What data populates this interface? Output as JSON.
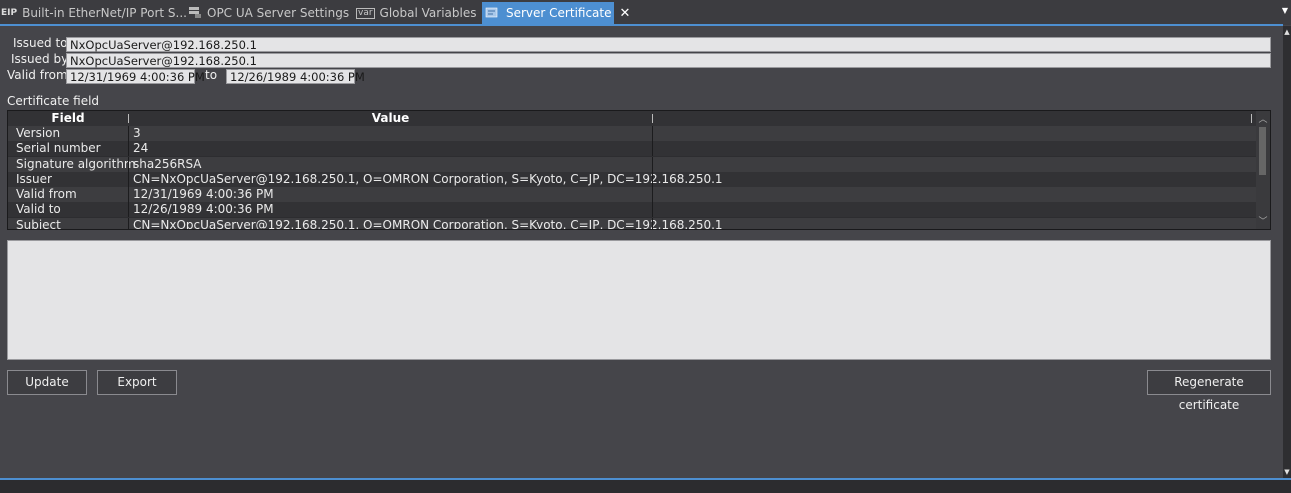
{
  "tabs": [
    {
      "icon": "EIP",
      "label": "Built-in EtherNet/IP Port S..."
    },
    {
      "icon": "opc",
      "label": "OPC UA Server Settings"
    },
    {
      "icon": "var",
      "label": "Global Variables"
    },
    {
      "icon": "cert",
      "label": "Server Certificate"
    }
  ],
  "active_tab": 3,
  "form": {
    "issued_to_label": "Issued to",
    "issued_to_value": "NxOpcUaServer@192.168.250.1",
    "issued_by_label": "Issued by",
    "issued_by_value": "NxOpcUaServer@192.168.250.1",
    "valid_from_label": "Valid from",
    "valid_from_value": "12/31/1969 4:00:36 PM",
    "to_label": "to",
    "valid_to_value": "12/26/1989 4:00:36 PM"
  },
  "certificate_field_label": "Certificate field",
  "grid": {
    "headers": [
      "Field",
      "Value"
    ],
    "rows": [
      [
        "Version",
        "3"
      ],
      [
        "Serial number",
        "24"
      ],
      [
        "Signature algorithm",
        "sha256RSA"
      ],
      [
        "Issuer",
        "CN=NxOpcUaServer@192.168.250.1, O=OMRON Corporation, S=Kyoto, C=JP, DC=192.168.250.1"
      ],
      [
        "Valid from",
        "12/31/1969 4:00:36 PM"
      ],
      [
        "Valid to",
        "12/26/1989 4:00:36 PM"
      ],
      [
        "Subject",
        "CN=NxOpcUaServer@192.168.250.1, O=OMRON Corporation, S=Kyoto, C=JP, DC=192.168.250.1"
      ]
    ]
  },
  "buttons": {
    "update": "Update",
    "export": "Export",
    "regenerate": "Regenerate certificate"
  },
  "colors": {
    "accent": "#4d8fd1",
    "background": "#45454a",
    "field_bg": "#e4e4e6"
  }
}
